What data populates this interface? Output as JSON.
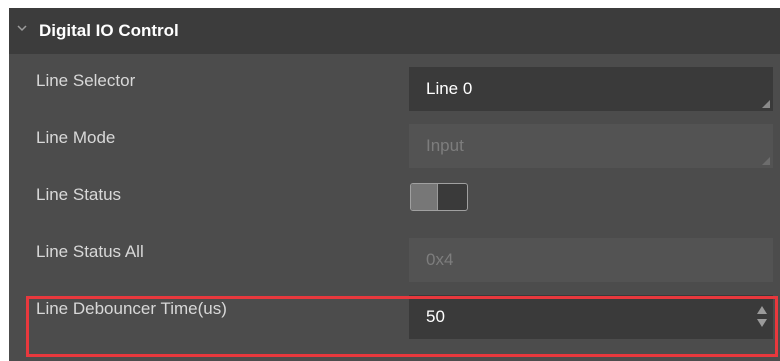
{
  "section": {
    "title": "Digital IO Control",
    "expanded": true,
    "collapse_icon": "chevron-down-icon"
  },
  "rows": [
    {
      "label": "Line Selector",
      "value": "Line 0",
      "type": "dropdown",
      "enabled": true
    },
    {
      "label": "Line Mode",
      "value": "Input",
      "type": "dropdown",
      "enabled": false
    },
    {
      "label": "Line Status",
      "type": "toggle",
      "on": false
    },
    {
      "label": "Line Status All",
      "value": "0x4",
      "type": "text",
      "enabled": false
    },
    {
      "label": "Line Debouncer Time(us)",
      "value": "50",
      "type": "spinbox",
      "enabled": true,
      "highlighted": true
    }
  ],
  "colors": {
    "panel_bg": "#4c4c4c",
    "header_bg": "#3c3c3c",
    "field_active_bg": "#3a3a3a",
    "field_disabled_bg": "#535353",
    "highlight_border": "#e8383d"
  }
}
